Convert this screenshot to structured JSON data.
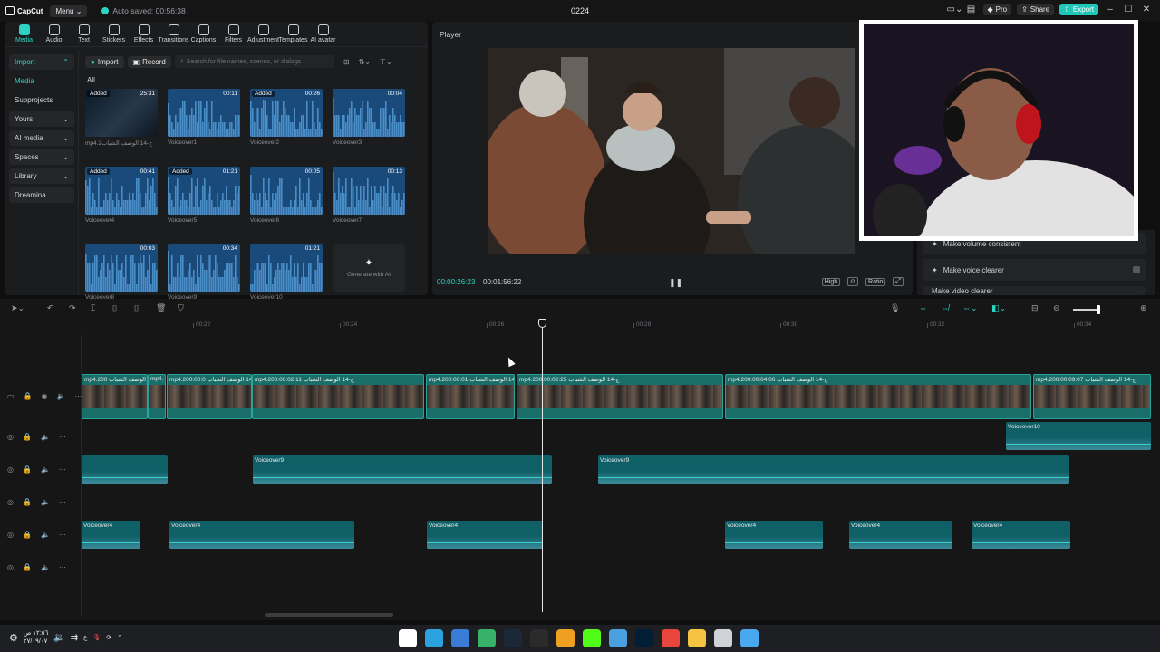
{
  "titlebar": {
    "app_name": "CapCut",
    "menu_label": "Menu",
    "autosave_text": "Auto saved: 00:56:38",
    "project_title": "0224",
    "pro_label": "Pro",
    "share_label": "Share",
    "export_label": "Export"
  },
  "media_tabs": [
    {
      "label": "Media",
      "icon": "media-icon"
    },
    {
      "label": "Audio",
      "icon": "audio-icon"
    },
    {
      "label": "Text",
      "icon": "text-icon"
    },
    {
      "label": "Stickers",
      "icon": "stickers-icon"
    },
    {
      "label": "Effects",
      "icon": "effects-icon"
    },
    {
      "label": "Transitions",
      "icon": "transitions-icon"
    },
    {
      "label": "Captions",
      "icon": "captions-icon"
    },
    {
      "label": "Filters",
      "icon": "filters-icon"
    },
    {
      "label": "Adjustment",
      "icon": "adjustment-icon"
    },
    {
      "label": "Templates",
      "icon": "templates-icon"
    },
    {
      "label": "AI avatar",
      "icon": "ai-avatar-icon"
    }
  ],
  "sidebar": [
    {
      "label": "Import"
    },
    {
      "label": "Media"
    },
    {
      "label": "Subprojects"
    },
    {
      "label": "Yours"
    },
    {
      "label": "AI media"
    },
    {
      "label": "Spaces"
    },
    {
      "label": "Library"
    },
    {
      "label": "Dreamina"
    }
  ],
  "media_toolbar": {
    "import_label": "Import",
    "record_label": "Record",
    "search_placeholder": "Search for file names, scenes, or dialogs",
    "filter_all": "All"
  },
  "media_items": [
    {
      "name": "mp4.2ج-14 الوصف الشباب",
      "duration": "25:31",
      "added": "Added",
      "type": "video"
    },
    {
      "name": "Voiceover1",
      "duration": "00:11",
      "added": "",
      "type": "audio"
    },
    {
      "name": "Voiceover2",
      "duration": "00:26",
      "added": "Added",
      "type": "audio"
    },
    {
      "name": "Voiceover3",
      "duration": "00:04",
      "added": "",
      "type": "audio"
    },
    {
      "name": "Voiceover4",
      "duration": "00:41",
      "added": "Added",
      "type": "audio"
    },
    {
      "name": "Voiceover5",
      "duration": "01:21",
      "added": "Added",
      "type": "audio"
    },
    {
      "name": "Voiceover6",
      "duration": "00:05",
      "added": "",
      "type": "audio"
    },
    {
      "name": "Voiceover7",
      "duration": "00:13",
      "added": "",
      "type": "audio"
    },
    {
      "name": "Voiceover8",
      "duration": "00:03",
      "added": "",
      "type": "audio"
    },
    {
      "name": "Voiceover9",
      "duration": "00:34",
      "added": "",
      "type": "audio"
    },
    {
      "name": "Voiceover10",
      "duration": "01:21",
      "added": "",
      "type": "audio"
    }
  ],
  "generate_ai_label": "Generate with AI",
  "player": {
    "title": "Player",
    "current_time": "00:00:26:23",
    "total_time": "00:01:56:22",
    "quality_label": "High",
    "ratio_label": "Ratio"
  },
  "right_panel": {
    "items": [
      "Make volume consistent",
      "Make voice clearer",
      "Make video clearer"
    ]
  },
  "timeline": {
    "ruler_ticks": [
      "00:22",
      "00:24",
      "00:26",
      "00:28",
      "00:30",
      "00:32",
      "00:34"
    ],
    "video_clips": [
      {
        "label": "mp4.2ج-14 الوصف الشباب  00:"
      },
      {
        "label": "mp4."
      },
      {
        "label": "mp4.2ج-14 الوصف الشباب  00:00:0"
      },
      {
        "label": "mp4.2ج-14 الوصف الشباب  00:00:02:11"
      },
      {
        "label": "mp4.2ج-14 الوصف الشباب  00:00:01"
      },
      {
        "label": "mp4.2ج-14 الوصف الشباب  00:00:02:25"
      },
      {
        "label": "mp4.2ج-14 الوصف الشباب  00:00:04:06"
      },
      {
        "label": "mp4.2ج-14 الوصف الشباب  00:00:09:07"
      }
    ],
    "voiceover10_label": "Voiceover10",
    "voiceover9_clips": [
      {
        "label": ""
      },
      {
        "label": "Voiceover9"
      },
      {
        "label": "Voiceover9"
      }
    ],
    "voiceover4_clips": [
      {
        "label": "Voiceover4"
      },
      {
        "label": "Voiceover4"
      },
      {
        "label": "Voiceover4"
      },
      {
        "label": "Voiceover4"
      },
      {
        "label": "Voiceover4"
      },
      {
        "label": "Voiceover4"
      }
    ]
  },
  "taskbar": {
    "clock_time": "١٢:٥٦ ص",
    "clock_date": "٢٧/٠٩/٠٧",
    "lang": "ع"
  },
  "colors": {
    "accent": "#2dd4c4",
    "video_clip": "#1a6e6a",
    "audio_clip": "#0f5f67",
    "thumb_audio": "#1a4a7a"
  }
}
